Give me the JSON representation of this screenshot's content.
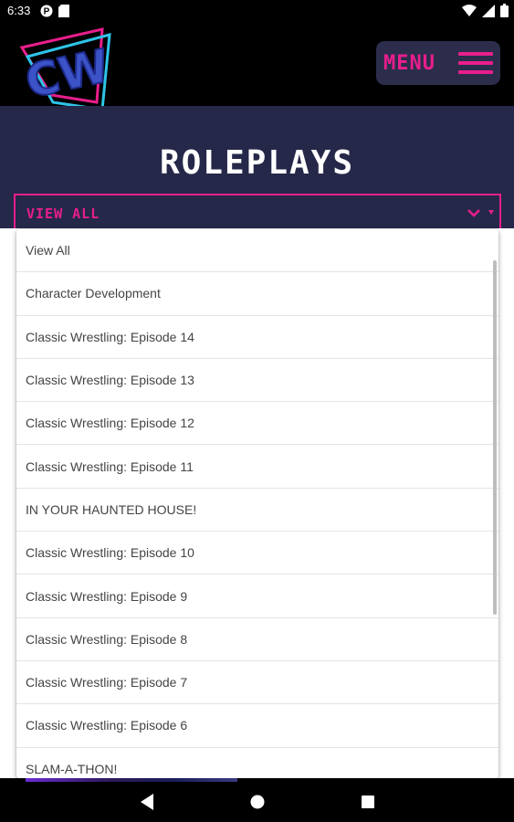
{
  "status_bar": {
    "time": "6:33",
    "icons": [
      "p-badge-icon",
      "sd-card-icon",
      "wifi-icon",
      "signal-icon",
      "battery-icon"
    ]
  },
  "header": {
    "logo_text": "CW",
    "menu_label": "MENU"
  },
  "page": {
    "title": "ROLEPLAYS"
  },
  "filter": {
    "selected": "VIEW ALL"
  },
  "dropdown": {
    "options": [
      "View All",
      "Character Development",
      "Classic Wrestling: Episode 14",
      "Classic Wrestling: Episode 13",
      "Classic Wrestling: Episode 12",
      "Classic Wrestling: Episode 11",
      "IN YOUR HAUNTED HOUSE!",
      "Classic Wrestling: Episode 10",
      "Classic Wrestling: Episode 9",
      "Classic Wrestling: Episode 8",
      "Classic Wrestling: Episode 7",
      "Classic Wrestling: Episode 6",
      "SLAM-A-THON!"
    ]
  },
  "nav": {
    "buttons": [
      "back-icon",
      "home-icon",
      "recents-icon"
    ]
  },
  "colors": {
    "accent": "#e91e8c",
    "band": "#252849",
    "menu_bg": "#2b2d4b"
  }
}
